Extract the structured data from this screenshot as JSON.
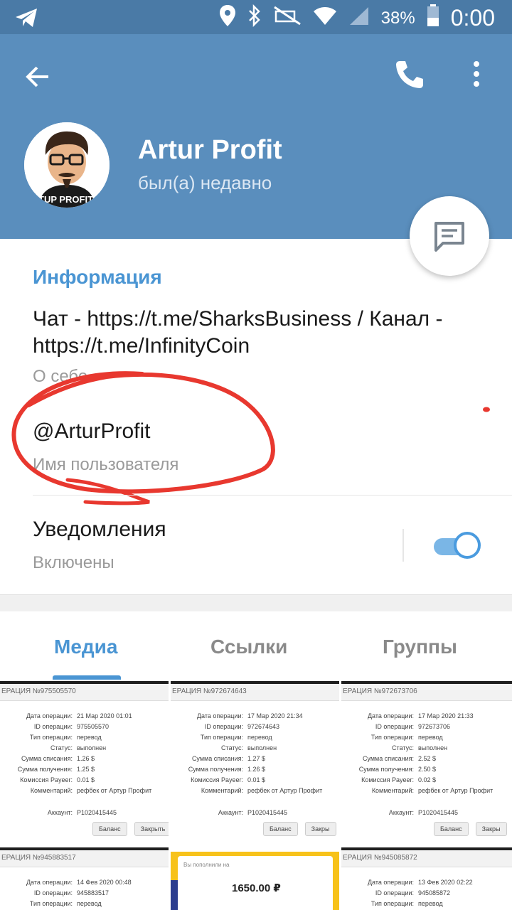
{
  "status_bar": {
    "battery_percent": "38%",
    "time": "0:00"
  },
  "profile": {
    "name": "Artur Profit",
    "last_seen": "был(а) недавно",
    "avatar_text": "TUP PROFIT"
  },
  "info": {
    "section_title": "Информация",
    "bio": "Чат - https://t.me/SharksBusiness / Канал - https://t.me/InfinityCoin",
    "bio_caption": "О себе",
    "username": "@ArturProfit",
    "username_caption": "Имя пользователя"
  },
  "notifications": {
    "label": "Уведомления",
    "status": "Включены",
    "enabled": true
  },
  "tabs": [
    {
      "label": "Медиа",
      "active": true
    },
    {
      "label": "Ссылки",
      "active": false
    },
    {
      "label": "Группы",
      "active": false
    }
  ],
  "media": {
    "cells": [
      {
        "title": "ЕРАЦИЯ №975505570",
        "rows": [
          {
            "label": "Дата операции:",
            "value": "21 Мар 2020 01:01"
          },
          {
            "label": "ID операции:",
            "value": "975505570"
          },
          {
            "label": "Тип операции:",
            "value": "перевод"
          },
          {
            "label": "Статус:",
            "value": "выполнен"
          },
          {
            "label": "Сумма списания:",
            "value": "1.26 $"
          },
          {
            "label": "Сумма получения:",
            "value": "1.25 $"
          },
          {
            "label": "Комиссия Payeer:",
            "value": "0.01 $"
          },
          {
            "label": "Комментарий:",
            "value": "рефбек от Артур Профит"
          }
        ],
        "account_label": "Аккаунт:",
        "account": "P1020415445",
        "btn1": "Баланс",
        "btn2": "Закрыть"
      },
      {
        "title": "ЕРАЦИЯ №972674643",
        "rows": [
          {
            "label": "Дата операции:",
            "value": "17 Мар 2020 21:34"
          },
          {
            "label": "ID операции:",
            "value": "972674643"
          },
          {
            "label": "Тип операции:",
            "value": "перевод"
          },
          {
            "label": "Статус:",
            "value": "выполнен"
          },
          {
            "label": "Сумма списания:",
            "value": "1.27 $"
          },
          {
            "label": "Сумма получения:",
            "value": "1.26 $"
          },
          {
            "label": "Комиссия Payeer:",
            "value": "0.01 $"
          },
          {
            "label": "Комментарий:",
            "value": "рефбек от Артур Профит"
          }
        ],
        "account_label": "Аккаунт:",
        "account": "P1020415445",
        "btn1": "Баланс",
        "btn2": "Закры"
      },
      {
        "title": "ЕРАЦИЯ №972673706",
        "rows": [
          {
            "label": "Дата операции:",
            "value": "17 Мар 2020 21:33"
          },
          {
            "label": "ID операции:",
            "value": "972673706"
          },
          {
            "label": "Тип операции:",
            "value": "перевод"
          },
          {
            "label": "Статус:",
            "value": "выполнен"
          },
          {
            "label": "Сумма списания:",
            "value": "2.52 $"
          },
          {
            "label": "Сумма получения:",
            "value": "2.50 $"
          },
          {
            "label": "Комиссия Payeer:",
            "value": "0.02 $"
          },
          {
            "label": "Комментарий:",
            "value": "рефбек от Артур Профит"
          }
        ],
        "account_label": "Аккаунт:",
        "account": "P1020415445",
        "btn1": "Баланс",
        "btn2": "Закры"
      },
      {
        "title": "ЕРАЦИЯ №945883517",
        "rows": [
          {
            "label": "Дата операции:",
            "value": "14 Фев 2020 00:48"
          },
          {
            "label": "ID операции:",
            "value": "945883517"
          },
          {
            "label": "Тип операции:",
            "value": "перевод"
          }
        ]
      },
      {
        "title": "Вы пополнили на",
        "amount": "1650.00 ₽"
      },
      {
        "title": "ЕРАЦИЯ №945085872",
        "rows": [
          {
            "label": "Дата операции:",
            "value": "13 Фев 2020 02:22"
          },
          {
            "label": "ID операции:",
            "value": "945085872"
          },
          {
            "label": "Тип операции:",
            "value": "перевод"
          }
        ]
      }
    ]
  },
  "colors": {
    "header": "#5a8ebd",
    "status_bar": "#4a7aa6",
    "accent": "#4a95d3",
    "annotation": "#e8382f"
  }
}
